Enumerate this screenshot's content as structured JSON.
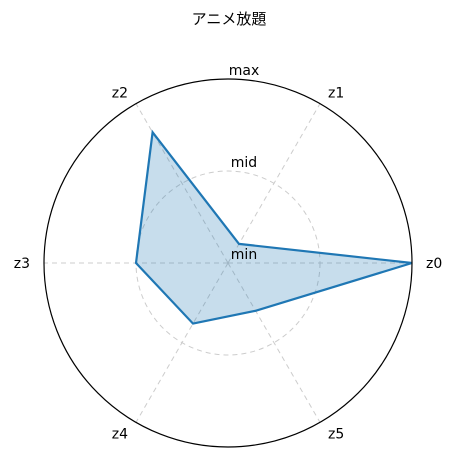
{
  "chart_data": {
    "type": "radar",
    "title": "アニメ放題",
    "axes": [
      "z0",
      "z1",
      "z2",
      "z3",
      "z4",
      "z5"
    ],
    "radial_labels": [
      "min",
      "mid",
      "max"
    ],
    "series": [
      {
        "values": [
          1.0,
          0.12,
          0.82,
          0.5,
          0.38,
          0.3
        ]
      }
    ],
    "range": [
      0,
      1
    ],
    "grid": true,
    "colors": {
      "line": "#1f77b4",
      "fill": "#1f77b4",
      "grid": "#cccccc",
      "frame": "#000000"
    }
  }
}
